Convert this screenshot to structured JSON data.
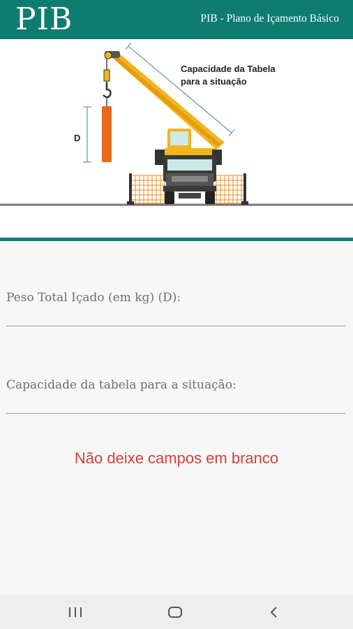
{
  "app_bar": {
    "logo": "PIB",
    "title": "PIB - Plano de Içamento Básico",
    "background_color": "#0e7c71"
  },
  "illustration": {
    "capacity_label_line1": "Capacidade da Tabela",
    "capacity_label_line2": "para a situação",
    "weight_label": "D"
  },
  "form": {
    "peso_label": "Peso Total Içado (em kg) (D):",
    "peso_value": "",
    "capacidade_label": "Capacidade da tabela para a situação:",
    "capacidade_value": ""
  },
  "error_message": "Não deixe campos em branco",
  "error_color": "#d4403a",
  "nav": {
    "recent_icon": "recent-apps-icon",
    "home_icon": "home-icon",
    "back_icon": "back-icon"
  }
}
